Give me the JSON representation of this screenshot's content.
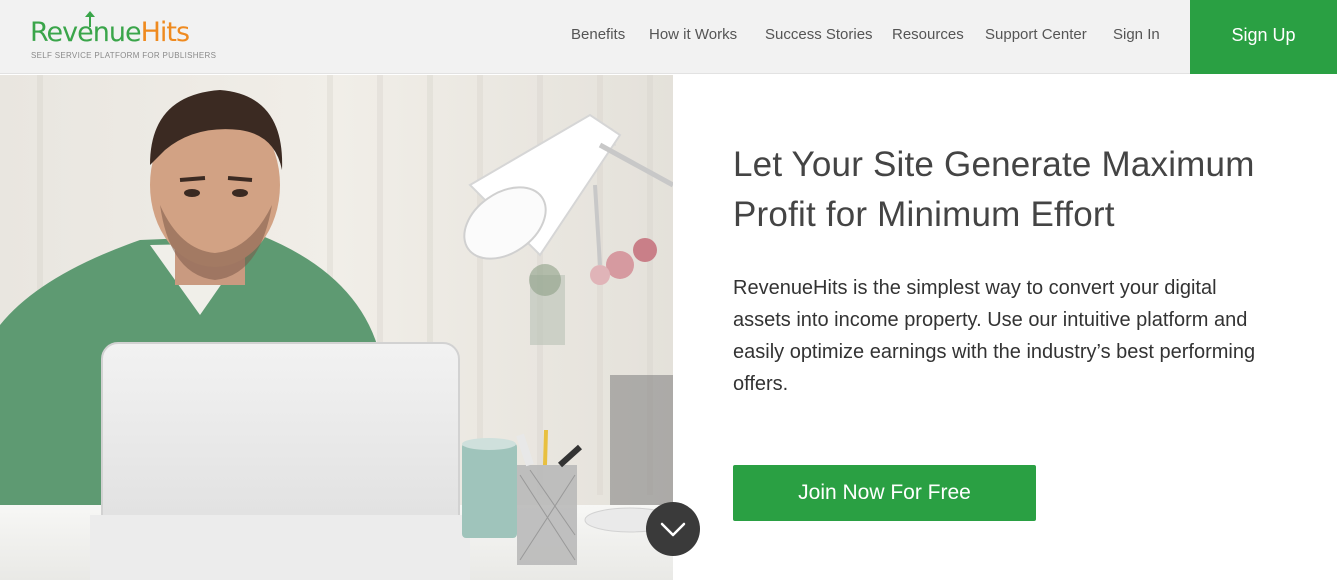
{
  "brand": {
    "name_part1": "Revenue",
    "name_part2": "Hits",
    "tagline": "SELF SERVICE PLATFORM FOR PUBLISHERS",
    "color_green": "#3aa54a",
    "color_orange": "#ef8a1f"
  },
  "nav": {
    "items": [
      {
        "label": "Benefits"
      },
      {
        "label": "How it Works"
      },
      {
        "label": "Success Stories"
      },
      {
        "label": "Resources"
      },
      {
        "label": "Support Center"
      },
      {
        "label": "Sign In"
      }
    ],
    "signup_label": "Sign Up",
    "accent": "#2aa043"
  },
  "hero": {
    "headline": "Let Your Site Generate Maximum Profit for Minimum Effort",
    "description": "RevenueHits is the simplest way to convert your digital assets into income property. Use our intuitive platform and easily optimize earnings with the industry’s best performing offers.",
    "cta_label": "Join Now For Free",
    "photo_icon": "man-at-laptop-photo",
    "scroll_icon": "chevron-down-icon"
  }
}
